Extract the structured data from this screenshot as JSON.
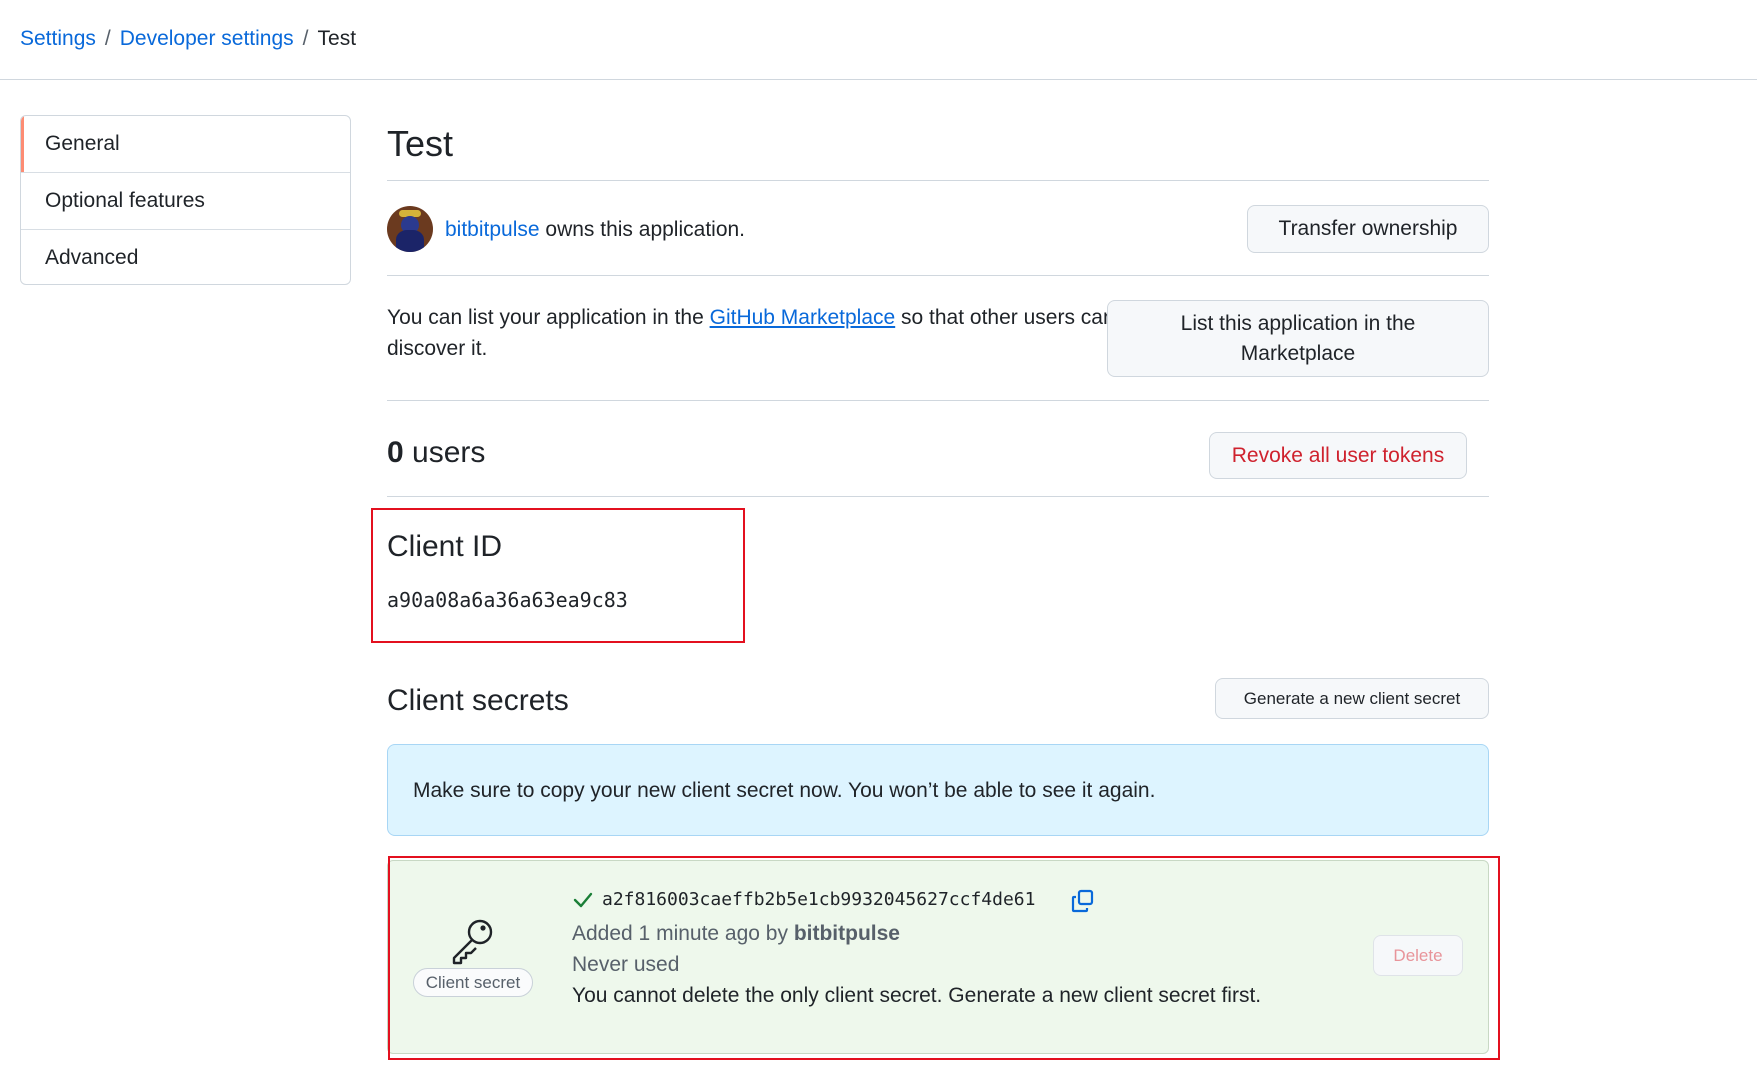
{
  "breadcrumb": {
    "settings": "Settings",
    "developer_settings": "Developer settings",
    "current": "Test",
    "separator": "/"
  },
  "sidebar": {
    "items": [
      {
        "label": "General",
        "active": true
      },
      {
        "label": "Optional features",
        "active": false
      },
      {
        "label": "Advanced",
        "active": false
      }
    ]
  },
  "page": {
    "title": "Test"
  },
  "owner": {
    "username": "bitbitpulse",
    "suffix": " owns this application.",
    "transfer_button": "Transfer ownership"
  },
  "marketplace": {
    "text_before": "You can list your application in the ",
    "link": "GitHub Marketplace",
    "text_after": " so that other users can discover it.",
    "button_line1": "List this application in the",
    "button_line2": "Marketplace"
  },
  "users": {
    "count": "0",
    "label": " users",
    "revoke_button": "Revoke all user tokens"
  },
  "client_id": {
    "title": "Client ID",
    "value": "a90a08a6a36a63ea9c83"
  },
  "client_secrets": {
    "title": "Client secrets",
    "generate_button": "Generate a new client secret",
    "flash": "Make sure to copy your new client secret now. You won’t be able to see it again.",
    "secret": {
      "label": "Client secret",
      "value": "a2f816003caeffb2b5e1cb9932045627ccf4de61",
      "added_prefix": "Added 1 minute ago by ",
      "added_by": "bitbitpulse",
      "usage": "Never used",
      "note": "You cannot delete the only client secret. Generate a new client secret first.",
      "delete_button": "Delete"
    }
  },
  "colors": {
    "link": "#0969da",
    "danger": "#cf222e",
    "success": "#1a7f37",
    "highlight": "#e3101f",
    "flash_bg": "#ddf4ff",
    "secret_bg": "#eef8ec"
  }
}
